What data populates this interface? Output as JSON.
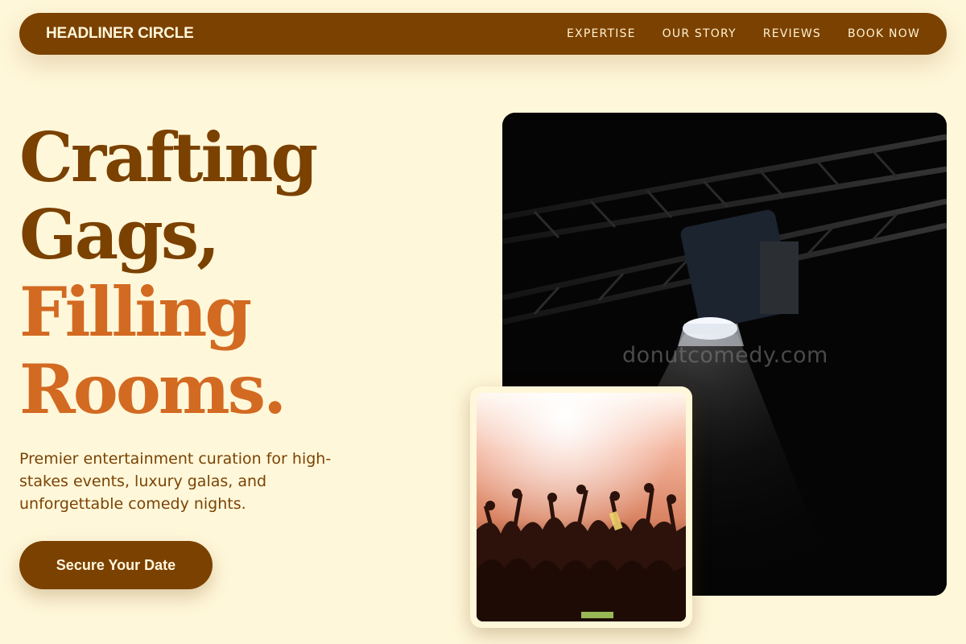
{
  "nav": {
    "brand": "HEADLINER CIRCLE",
    "links": [
      "EXPERTISE",
      "OUR STORY",
      "REVIEWS",
      "BOOK NOW"
    ]
  },
  "hero": {
    "headline_lines": [
      "Crafting",
      "Gags,",
      "Filling",
      "Rooms."
    ],
    "subtitle": "Premier entertainment curation for high-stakes events, luxury galas, and unforgettable comedy nights.",
    "cta_label": "Secure Your Date"
  },
  "images": {
    "stage_photo_watermark": "donutcomedy.com",
    "stage_photo_icon": "stage-spotlight-photo",
    "crowd_photo_icon": "concert-crowd-photo"
  },
  "colors": {
    "background": "#fff7d9",
    "nav_background": "#7b4100",
    "headline_dark": "#7b4100",
    "headline_accent": "#d36a22",
    "cta_background": "#7b4100"
  }
}
